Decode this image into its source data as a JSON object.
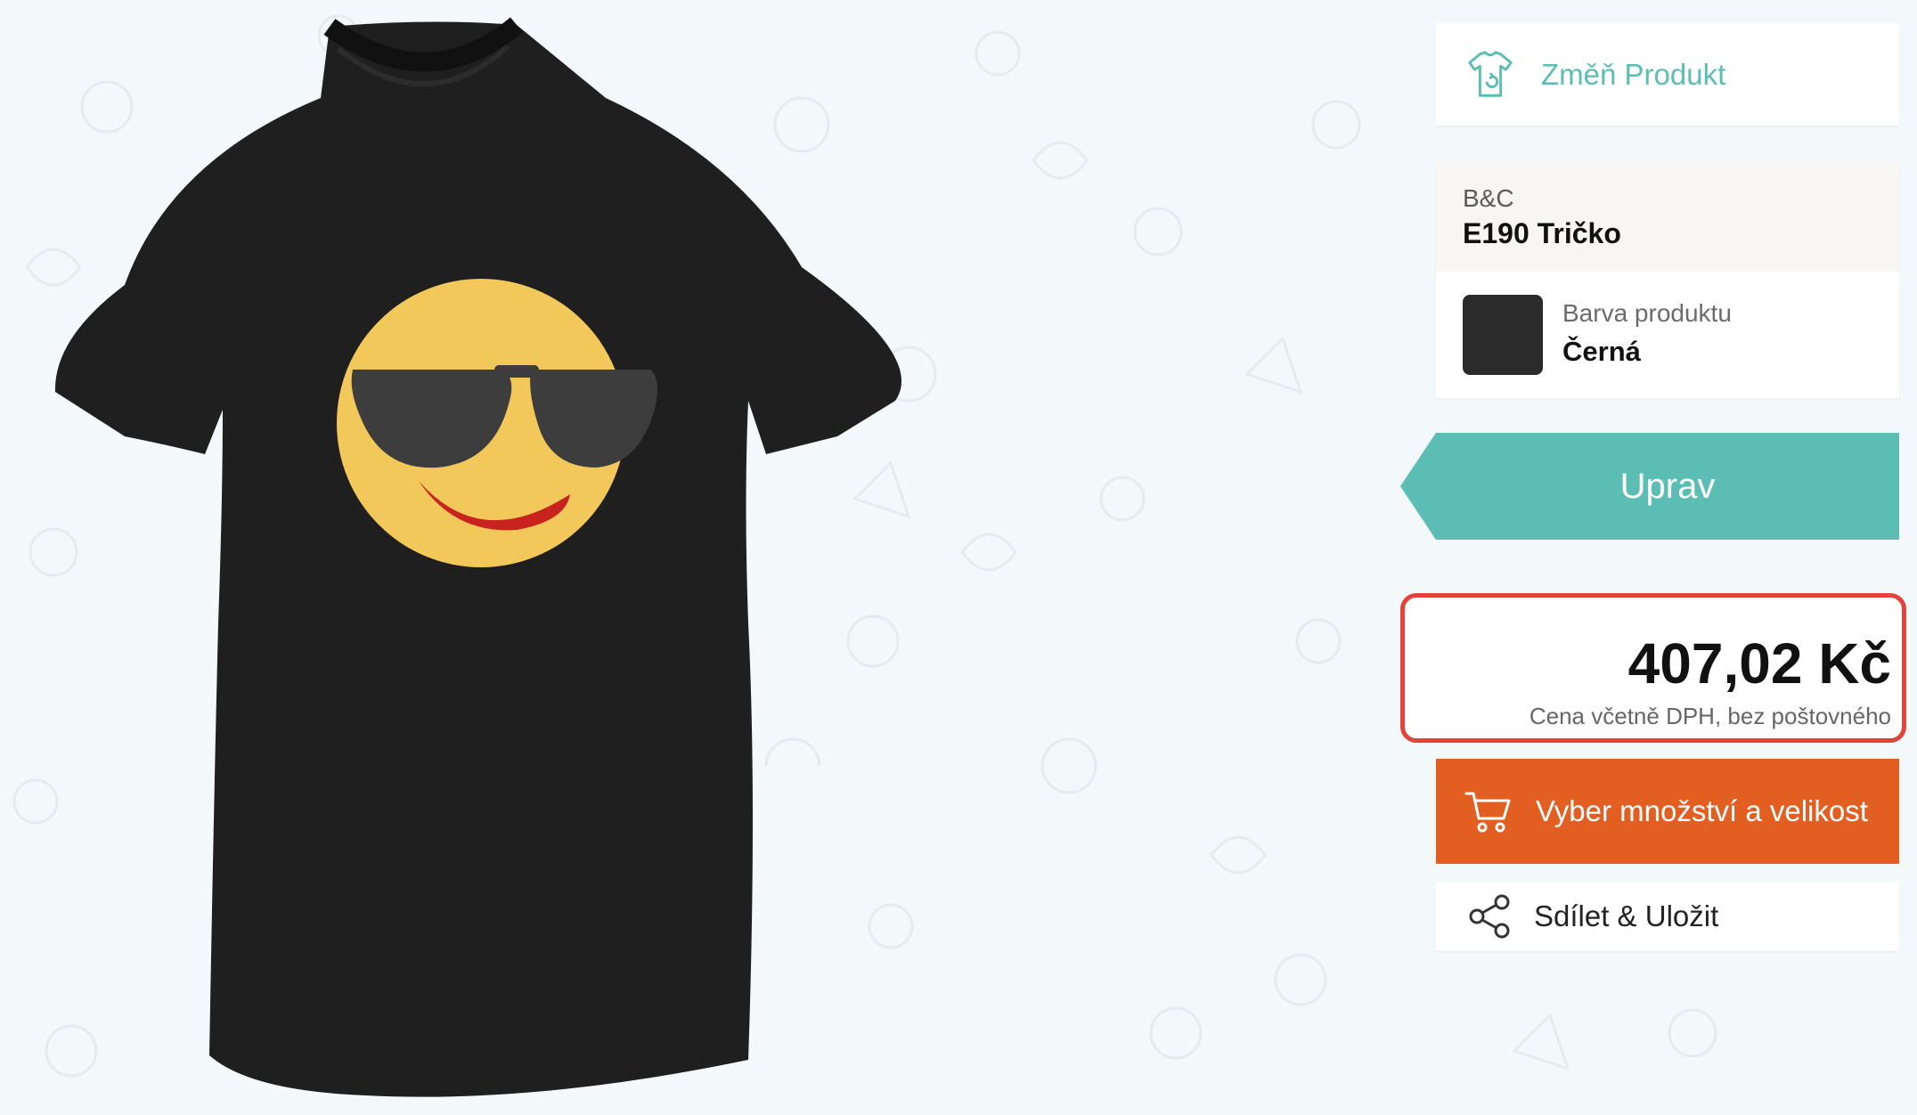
{
  "product_preview": {
    "garment_color": "#1f1f1f",
    "design": {
      "face_color": "#f2c85b",
      "glasses_color": "#3d3d3d",
      "mouth_color": "#c8231e"
    }
  },
  "change_product": {
    "label": "Změň Produkt",
    "icon": "tshirt-swap-icon",
    "color": "#5bbdb4"
  },
  "product_info": {
    "brand": "B&C",
    "name": "E190 Tričko",
    "color_label": "Barva produktu",
    "color_value": "Černá",
    "swatch_color": "#2b2b2b"
  },
  "edit_button": {
    "label": "Uprav",
    "color": "#5bbdb4"
  },
  "price": {
    "amount": "407,02 Kč",
    "note": "Cena včetně DPH, bez poštovného",
    "highlight_color": "#e4423a"
  },
  "buy_button": {
    "label": "Vyber množství a velikost",
    "icon": "cart-icon",
    "color": "#e35f21"
  },
  "share_button": {
    "label": "Sdílet & Uložit",
    "icon": "share-icon"
  }
}
